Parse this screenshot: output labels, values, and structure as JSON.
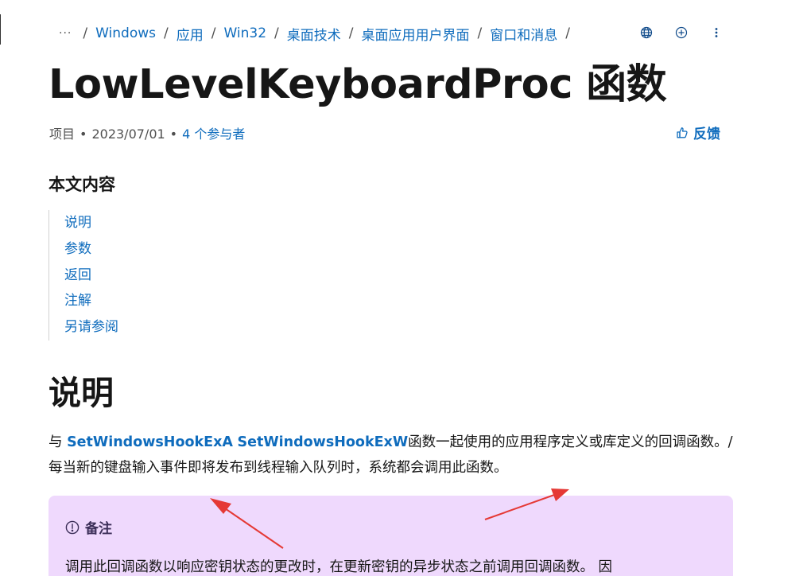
{
  "breadcrumb": {
    "more_label": "···",
    "items": [
      "Windows",
      "应用",
      "Win32",
      "桌面技术",
      "桌面应用用户界面",
      "窗口和消息"
    ],
    "separator": "/"
  },
  "top_actions": {
    "icons": [
      "globe-icon",
      "add-circle-icon",
      "more-vertical-icon"
    ]
  },
  "title": "LowLevelKeyboardProc 函数",
  "meta": {
    "type": "项目",
    "date": "2023/07/01",
    "contributors": "4 个参与者",
    "bullet": "•"
  },
  "feedback": {
    "label": "反馈",
    "icon": "thumbs-up-icon"
  },
  "toc": {
    "heading": "本文内容",
    "items": [
      "说明",
      "参数",
      "返回",
      "注解",
      "另请参阅"
    ]
  },
  "section": {
    "title": "说明",
    "desc_prefix": "与 ",
    "link1": "SetWindowsHookExA",
    "link_gap": " ",
    "link2": "SetWindowsHookExW",
    "desc_rest": "函数一起使用的应用程序定义或库定义的回调函数。/ 每当新的键盘输入事件即将发布到线程输入队列时，系统都会调用此函数。"
  },
  "note": {
    "title": "备注",
    "icon": "info-circle-icon",
    "body": "调用此回调函数以响应密钥状态的更改时，在更新密钥的异步状态之前调用回调函数。 因"
  },
  "colors": {
    "link": "#0f6cbd",
    "note_bg": "#efd9fd",
    "annotation": "#e53935"
  }
}
